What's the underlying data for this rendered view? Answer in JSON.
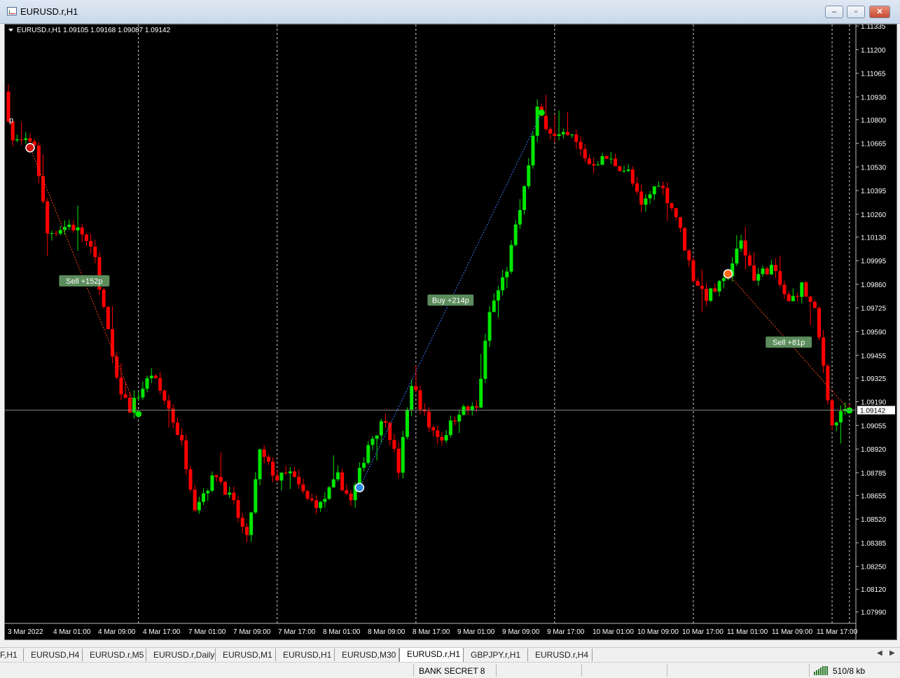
{
  "window": {
    "title": "EURUSD.r,H1",
    "minimize": "‒",
    "maximize": "▫",
    "close": "✕"
  },
  "chart_data": {
    "type": "candlestick",
    "symbol_info": "EURUSD.r,H1  1.09105 1.09168 1.09087 1.09142",
    "ylim": [
      1.07925,
      1.11335
    ],
    "y_ticks": [
      "1.11335",
      "1.11200",
      "1.11065",
      "1.10930",
      "1.10800",
      "1.10665",
      "1.10530",
      "1.10395",
      "1.10260",
      "1.10130",
      "1.09995",
      "1.09860",
      "1.09725",
      "1.09590",
      "1.09455",
      "1.09325",
      "1.09190",
      "1.09055",
      "1.08920",
      "1.08785",
      "1.08655",
      "1.08520",
      "1.08385",
      "1.08250",
      "1.08120",
      "1.07990"
    ],
    "x_ticks": [
      "3 Mar 2022",
      "4 Mar 01:00",
      "4 Mar 09:00",
      "4 Mar 17:00",
      "7 Mar 01:00",
      "7 Mar 09:00",
      "7 Mar 17:00",
      "8 Mar 01:00",
      "8 Mar 09:00",
      "8 Mar 17:00",
      "9 Mar 01:00",
      "9 Mar 09:00",
      "9 Mar 17:00",
      "10 Mar 01:00",
      "10 Mar 09:00",
      "10 Mar 17:00",
      "11 Mar 01:00",
      "11 Mar 09:00",
      "11 Mar 17:00"
    ],
    "current_price": "1.09142",
    "price_marker_label": "p",
    "colors": {
      "bull": "#00e600",
      "bear": "#ff0000",
      "grid": "#cfcfcf",
      "price_line": "#8a8a8a",
      "sell_line": "#ff4a1a",
      "buy_line": "#3a7dff",
      "trade_label_bg": "#5c8c5c"
    },
    "trades": [
      {
        "direction": "sell",
        "label": "Sell +152p",
        "entry": 1.1064,
        "exit": 1.0912
      },
      {
        "direction": "buy",
        "label": "Buy +214p",
        "entry": 1.087,
        "exit": 1.1084
      },
      {
        "direction": "sell",
        "label": "Sell +81p",
        "entry": 1.0992,
        "exit": 1.0914
      }
    ],
    "anchors": [
      [
        0,
        1.1096
      ],
      [
        2,
        1.1068
      ],
      [
        7,
        1.1066
      ],
      [
        10,
        1.1015
      ],
      [
        15,
        1.102
      ],
      [
        18,
        1.1015
      ],
      [
        21,
        1.1
      ],
      [
        26,
        1.093
      ],
      [
        29,
        1.0915
      ],
      [
        34,
        1.0935
      ],
      [
        38,
        1.0915
      ],
      [
        41,
        1.0895
      ],
      [
        44,
        1.086
      ],
      [
        49,
        1.0878
      ],
      [
        53,
        1.086
      ],
      [
        56,
        1.084
      ],
      [
        59,
        1.089
      ],
      [
        63,
        1.0875
      ],
      [
        66,
        1.0878
      ],
      [
        70,
        1.0863
      ],
      [
        73,
        1.086
      ],
      [
        77,
        1.0876
      ],
      [
        80,
        1.0862
      ],
      [
        84,
        1.0895
      ],
      [
        88,
        1.091
      ],
      [
        91,
        1.088
      ],
      [
        94,
        1.093
      ],
      [
        98,
        1.0905
      ],
      [
        101,
        1.0898
      ],
      [
        105,
        1.0914
      ],
      [
        109,
        1.0915
      ],
      [
        112,
        1.097
      ],
      [
        116,
        1.0995
      ],
      [
        120,
        1.104
      ],
      [
        123,
        1.1085
      ],
      [
        127,
        1.107
      ],
      [
        131,
        1.107
      ],
      [
        135,
        1.1055
      ],
      [
        139,
        1.1058
      ],
      [
        144,
        1.105
      ],
      [
        147,
        1.103
      ],
      [
        151,
        1.1045
      ],
      [
        155,
        1.1025
      ],
      [
        159,
        1.099
      ],
      [
        162,
        1.0979
      ],
      [
        166,
        1.0987
      ],
      [
        170,
        1.101
      ],
      [
        173,
        1.099
      ],
      [
        177,
        1.0996
      ],
      [
        181,
        1.0975
      ],
      [
        184,
        1.0985
      ],
      [
        187,
        1.097
      ],
      [
        189,
        1.094
      ],
      [
        191,
        1.0905
      ],
      [
        194,
        1.09142
      ]
    ],
    "volatility": 0.00055
  },
  "tabs": {
    "items": [
      {
        "label": "F,H1"
      },
      {
        "label": "EURUSD,H4"
      },
      {
        "label": "EURUSD.r,M5"
      },
      {
        "label": "EURUSD.r,Daily"
      },
      {
        "label": "EURUSD,M1"
      },
      {
        "label": "EURUSD,H1"
      },
      {
        "label": "EURUSD,M30"
      },
      {
        "label": "EURUSD.r,H1",
        "active": true
      },
      {
        "label": "GBPJPY.r,H1"
      },
      {
        "label": "EURUSD.r,H4"
      }
    ],
    "scroll_left": "◀",
    "scroll_right": "▶"
  },
  "status": {
    "profile": "BANK SECRET 8",
    "traffic": "510/8 kb"
  }
}
